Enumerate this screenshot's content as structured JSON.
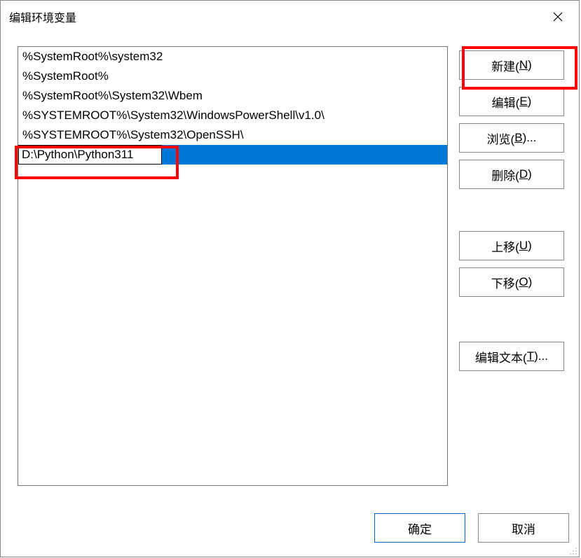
{
  "title": "编辑环境变量",
  "list": {
    "items": [
      "%SystemRoot%\\system32",
      "%SystemRoot%",
      "%SystemRoot%\\System32\\Wbem",
      "%SYSTEMROOT%\\System32\\WindowsPowerShell\\v1.0\\",
      "%SYSTEMROOT%\\System32\\OpenSSH\\",
      "D:\\Python\\Python311"
    ],
    "selected_index": 5,
    "editing_index": 5,
    "editing_value": "D:\\Python\\Python311"
  },
  "buttons": {
    "new_": "新建(",
    "new_u": "N",
    "new_tail": ")",
    "edit": "编辑(",
    "edit_u": "E",
    "edit_tail": ")",
    "browse": "浏览(",
    "browse_u": "B",
    "browse_tail": ")...",
    "delete": "删除(",
    "delete_u": "D",
    "delete_tail": ")",
    "up": "上移(",
    "up_u": "U",
    "up_tail": ")",
    "down": "下移(",
    "down_u": "O",
    "down_tail": ")",
    "edittext": "编辑文本(",
    "edittext_u": "T",
    "edittext_tail": ")..."
  },
  "footer": {
    "ok": "确定",
    "cancel": "取消"
  }
}
